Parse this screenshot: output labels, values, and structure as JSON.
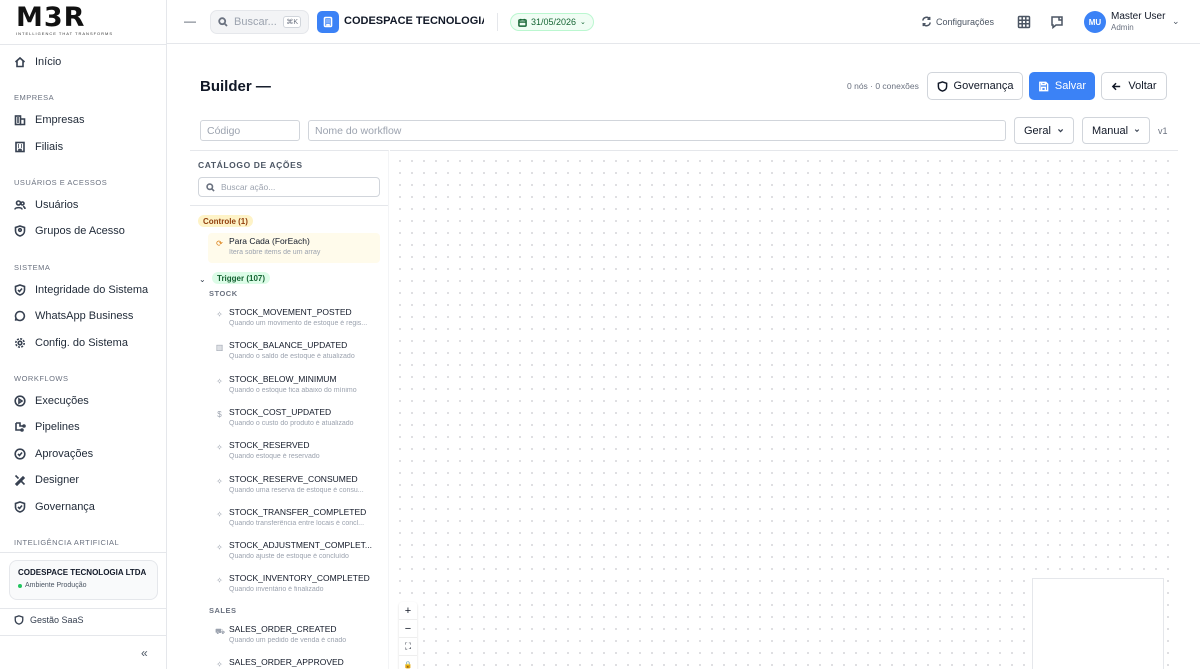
{
  "brand": {
    "logo": "M3R",
    "tagline": "INTELLIGENCE THAT TRANSFORMS"
  },
  "sidebar": {
    "home": "Início",
    "sections": {
      "empresa": "EMPRESA",
      "usuarios": "USUÁRIOS E ACESSOS",
      "sistema": "SISTEMA",
      "workflows": "WORKFLOWS",
      "ia": "INTELIGÊNCIA ARTIFICIAL"
    },
    "items": {
      "empresas": "Empresas",
      "filiais": "Filiais",
      "usuarios": "Usuários",
      "grupos": "Grupos de Acesso",
      "integridade": "Integridade do Sistema",
      "whatsapp": "WhatsApp Business",
      "config": "Config. do Sistema",
      "execucoes": "Execuções",
      "pipelines": "Pipelines",
      "aprovacoes": "Aprovações",
      "designer": "Designer",
      "governanca": "Governança"
    },
    "company_card": {
      "name": "CODESPACE TECNOLOGIA LTDA",
      "env": "Ambiente Produção"
    },
    "saas": "Gestão SaaS",
    "collapse": "«"
  },
  "topbar": {
    "search_placeholder": "Buscar...",
    "search_kbd": "⌘K",
    "company": "CODESPACE TECNOLOGIA ...",
    "date": "31/05/2026",
    "config": "Configurações",
    "user_initials": "MU",
    "user_name": "Master User",
    "user_role": "Admin"
  },
  "builder": {
    "title": "Builder —",
    "stats": "0 nós · 0 conexões",
    "btn_governanca": "Governança",
    "btn_salvar": "Salvar",
    "btn_voltar": "Voltar",
    "code_placeholder": "Código",
    "name_placeholder": "Nome do workflow",
    "category": "Geral",
    "trigger_mode": "Manual",
    "version": "v1"
  },
  "catalog": {
    "title": "CATÁLOGO DE AÇÕES",
    "search_placeholder": "Buscar ação...",
    "control_group": "Controle (1)",
    "control_item": {
      "title": "Para Cada (ForEach)",
      "desc": "Itera sobre items de um array"
    },
    "trigger_group": "Trigger (107)",
    "stock_label": "STOCK",
    "sales_label": "SALES",
    "stock_items": [
      {
        "title": "STOCK_MOVEMENT_POSTED",
        "desc": "Quando um movimento de estoque é regis...",
        "icon": "✧"
      },
      {
        "title": "STOCK_BALANCE_UPDATED",
        "desc": "Quando o saldo de estoque é atualizado",
        "icon": "▥"
      },
      {
        "title": "STOCK_BELOW_MINIMUM",
        "desc": "Quando o estoque fica abaixo do mínimo",
        "icon": "✧"
      },
      {
        "title": "STOCK_COST_UPDATED",
        "desc": "Quando o custo do produto é atualizado",
        "icon": "$"
      },
      {
        "title": "STOCK_RESERVED",
        "desc": "Quando estoque é reservado",
        "icon": "✧"
      },
      {
        "title": "STOCK_RESERVE_CONSUMED",
        "desc": "Quando uma reserva de estoque é consu...",
        "icon": "✧"
      },
      {
        "title": "STOCK_TRANSFER_COMPLETED",
        "desc": "Quando transferência entre locais é concl...",
        "icon": "✧"
      },
      {
        "title": "STOCK_ADJUSTMENT_COMPLET...",
        "desc": "Quando ajuste de estoque é concluído",
        "icon": "✧"
      },
      {
        "title": "STOCK_INVENTORY_COMPLETED",
        "desc": "Quando inventário é finalizado",
        "icon": "✧"
      }
    ],
    "sales_items": [
      {
        "title": "SALES_ORDER_CREATED",
        "desc": "Quando um pedido de venda é criado",
        "icon": "⛟"
      },
      {
        "title": "SALES_ORDER_APPROVED",
        "desc": "",
        "icon": "✧"
      }
    ]
  },
  "canvas": {
    "zoom_in": "+",
    "zoom_out": "−",
    "fit": "⛶",
    "lock": "🔒"
  }
}
